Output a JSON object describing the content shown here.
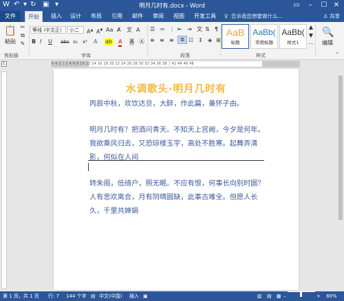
{
  "window": {
    "title": "明月几时有.docx - Word",
    "min_icon": "minimize-icon",
    "max_icon": "maximize-icon",
    "close_icon": "close-icon"
  },
  "tabs": {
    "file": "文件",
    "items": [
      "开始",
      "插入",
      "设计",
      "布局",
      "引用",
      "邮件",
      "审阅",
      "视图",
      "开发工具"
    ],
    "active": "开始",
    "tellme_placeholder": "告诉我您想要做什么...",
    "share": "共享"
  },
  "ribbon": {
    "clipboard": {
      "label": "剪贴板",
      "paste": "粘贴"
    },
    "font": {
      "label": "字体",
      "font_name": "等线 (中文正)",
      "font_size": "小二",
      "bold": "B",
      "italic": "I",
      "underline": "U",
      "strike": "abc",
      "sub": "x₂",
      "sup": "x²",
      "font_color_glyph": "A",
      "char_shade": "A",
      "change_case": "Aa",
      "highlight": "A"
    },
    "paragraph": {
      "label": "段落"
    },
    "styles": {
      "label": "样式",
      "items": [
        {
          "sample": "AaB",
          "name": "标题"
        },
        {
          "sample": "AaBb(",
          "name": "常用标题"
        },
        {
          "sample": "AaBb(",
          "name": "样式1"
        }
      ]
    },
    "editing": {
      "label": "编辑"
    }
  },
  "ruler": {
    "numbers": "6  4  2  │  2  4  6  8  10  12  14  16  18  20  22  24  26  28  30  32  34  36  38  │  42  44  46  48"
  },
  "document": {
    "title": "水调歌头·明月几时有",
    "paragraphs": [
      "丙辰中秋，欢饮达旦，大醉，作此篇，兼怀子由。",
      "明月几时有？把酒问青天。不知天上宫阙，今夕是何年。我欲乘风归去，又恐琼楼玉宇，高处不胜寒。起舞弄清影，何似在人间",
      "转朱阁，低绮户，照无眠。不应有恨，何事长向别时圆？人有悲欢离合，月有阴晴圆缺，此事古难全。但愿人长久，千里共婵娟"
    ]
  },
  "status": {
    "page": "第 1 页，共 1 页",
    "line": "行: 7",
    "words": "144 个字",
    "language": "中文(中国)",
    "mode": "插入",
    "zoom": "80%"
  },
  "colors": {
    "brand": "#2b579a",
    "title": "#f5b843",
    "body_text": "#3b5a9a"
  }
}
